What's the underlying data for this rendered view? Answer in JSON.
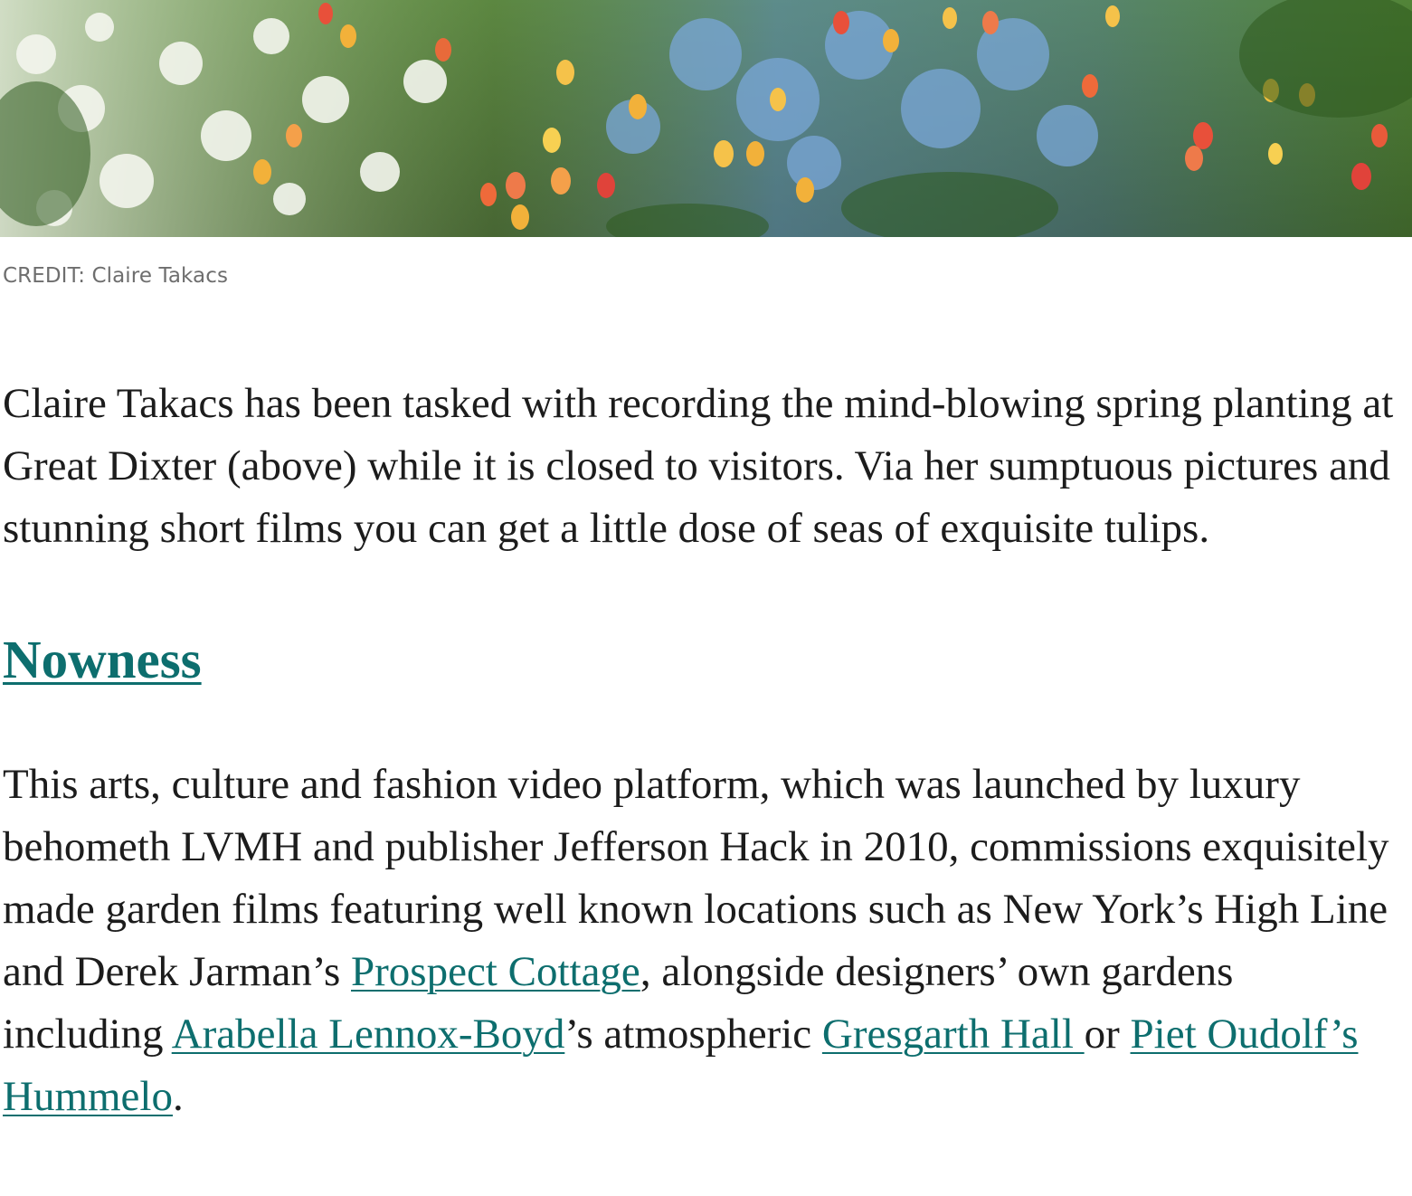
{
  "hero": {
    "alt_icon": "garden-photo"
  },
  "credit": {
    "text": "CREDIT: Claire Takacs"
  },
  "article": {
    "intro": "Claire Takacs has been tasked with recording the mind-blowing spring planting at Great Dixter (above) while it is closed to visitors. Via her sumptuous pictures and stunning short films you can get a little dose of seas of exquisite tulips.",
    "section_heading": "Nowness",
    "body": {
      "part1": "This arts, culture and fashion video platform, which was launched by luxury behometh LVMH and publisher Jefferson Hack in 2010, commissions exquisitely made garden films featuring well known locations such as New York’s High Line and Derek Jarman’s ",
      "link_prospect": "Prospect Cottage",
      "part2": ", alongside designers’ own gardens including ",
      "link_arabella": "Arabella Lennox-Boyd",
      "part3": "’s atmospheric ",
      "link_gresgarth": "Gresgarth Hall ",
      "part4": "or ",
      "link_piet": "Piet Oudolf’s Hummelo",
      "part5": "."
    }
  },
  "colors": {
    "link": "#0d6e6e",
    "text": "#1c1c1c",
    "credit": "#6e6e6e"
  }
}
